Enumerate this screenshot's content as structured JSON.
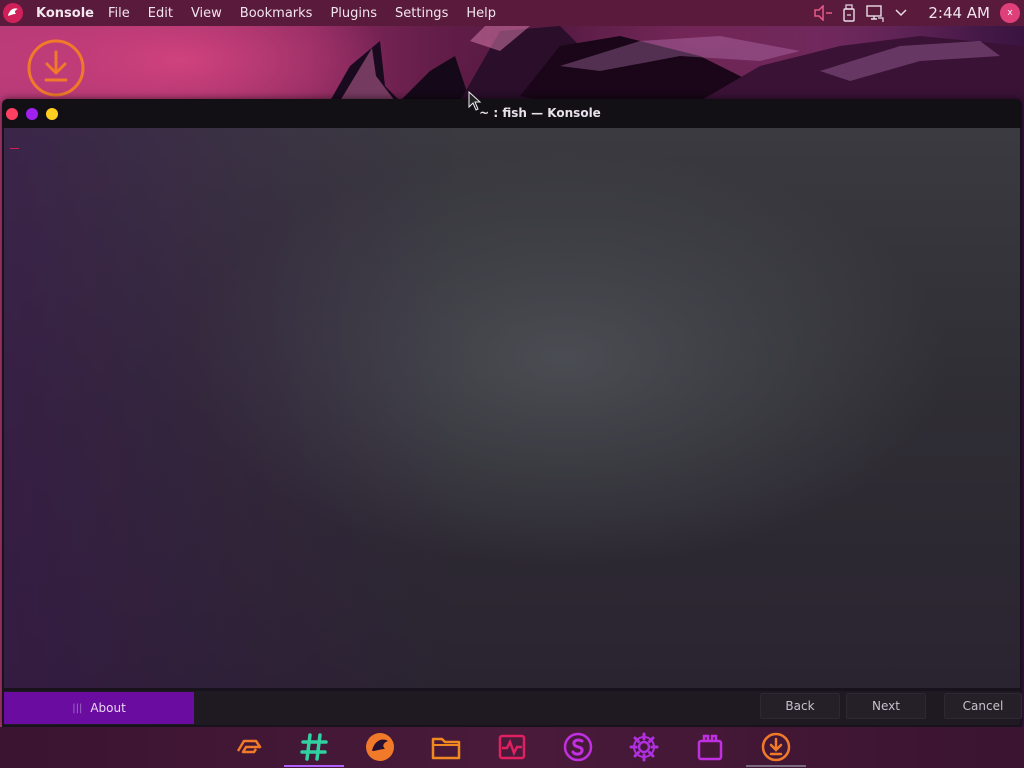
{
  "top_panel": {
    "app_name": "Konsole",
    "menu": [
      "File",
      "Edit",
      "View",
      "Bookmarks",
      "Plugins",
      "Settings",
      "Help"
    ],
    "clock": "2:44 AM",
    "user_initial": "x"
  },
  "window": {
    "title": "~ : fish — Konsole"
  },
  "bottom_bar": {
    "about_label": "About",
    "back_label": "Back",
    "next_label": "Next",
    "cancel_label": "Cancel"
  },
  "dock": {
    "items": [
      "garuda-icon",
      "hashtag-icon",
      "dragon-icon",
      "folder-icon",
      "system-monitor-icon",
      "s-icon",
      "settings-icon",
      "store-icon",
      "download-icon"
    ]
  },
  "colors": {
    "panel": "#5a1a3c",
    "accent": "#6a0ca0",
    "orange": "#f07a2a",
    "close": "#ff4060",
    "minimize": "#a020f0",
    "maximize": "#ffd020"
  }
}
